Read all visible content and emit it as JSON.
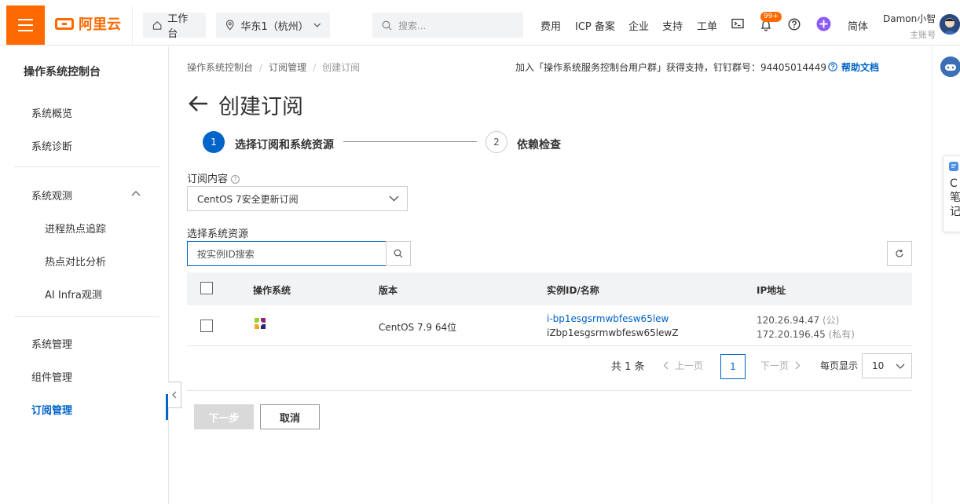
{
  "topbar": {
    "logo_text": "阿里云",
    "workbench": "工作台",
    "region": "华东1（杭州）",
    "search_placeholder": "搜索...",
    "nav": [
      "费用",
      "ICP 备案",
      "企业",
      "支持",
      "工单"
    ],
    "badge": "99+",
    "lang": "简体",
    "user_name": "Damon小智",
    "user_role": "主账号"
  },
  "sidebar": {
    "title": "操作系统控制台",
    "items": {
      "overview": "系统概览",
      "diagnosis": "系统诊断",
      "observe": "系统观测",
      "hotspot": "进程热点追踪",
      "compare": "热点对比分析",
      "ai_infra": "AI Infra观测",
      "manage": "系统管理",
      "component": "组件管理",
      "subscription": "订阅管理"
    }
  },
  "breadcrumb": {
    "l1": "操作系统控制台",
    "l2": "订阅管理",
    "l3": "创建订阅"
  },
  "notice": "加入「操作系统服务控制台用户群」获得支持，钉钉群号：94405014449",
  "help_label": "帮助文档",
  "page_title": "创建订阅",
  "steps": [
    {
      "num": "1",
      "label": "选择订阅和系统资源"
    },
    {
      "num": "2",
      "label": "依赖检查"
    }
  ],
  "form": {
    "sub_label": "订阅内容",
    "sub_value": "CentOS 7安全更新订阅",
    "res_label": "选择系统资源",
    "res_placeholder": "按实例ID搜索"
  },
  "table": {
    "headers": [
      "操作系统",
      "版本",
      "实例ID/名称",
      "IP地址"
    ],
    "rows": [
      {
        "version": "CentOS 7.9 64位",
        "instance_id": "i-bp1esgsrmwbfesw65lew",
        "instance_name": "iZbp1esgsrmwbfesw65lewZ",
        "ip_public": "120.26.94.47",
        "ip_public_tag": "(公)",
        "ip_private": "172.20.196.45",
        "ip_private_tag": "(私有)"
      }
    ]
  },
  "pagination": {
    "total": "共 1 条",
    "prev": "上一页",
    "current": "1",
    "next": "下一页",
    "per_page_label": "每页显示",
    "per_page": "10"
  },
  "buttons": {
    "next": "下一步",
    "cancel": "取消"
  },
  "right_rail": {
    "card_text": "C笔记"
  }
}
